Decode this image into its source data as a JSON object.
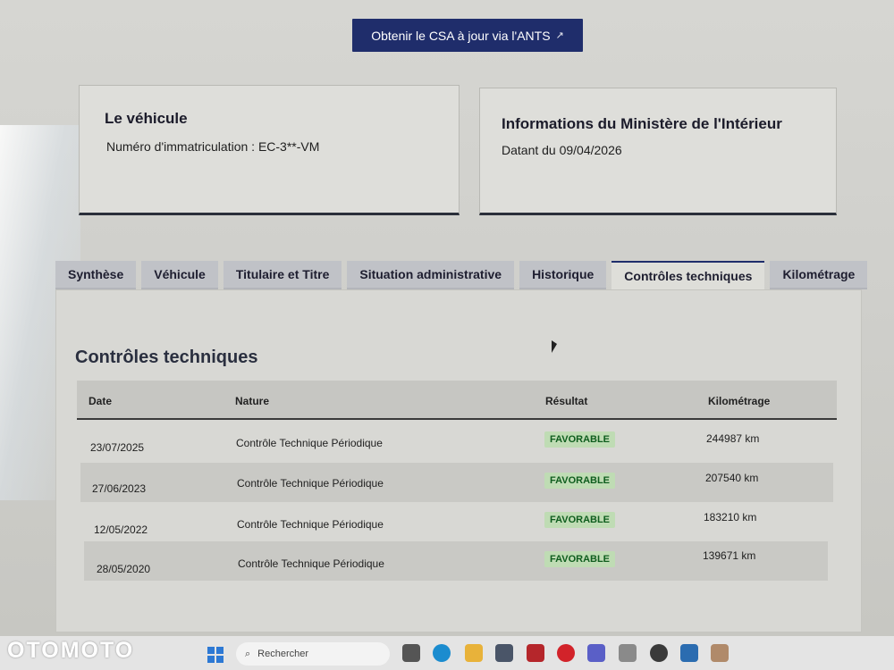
{
  "csa_button": {
    "label": "Obtenir le CSA à jour via l'ANTS",
    "icon": "external-link-icon"
  },
  "vehicle_card": {
    "title": "Le véhicule",
    "registration": "Numéro d'immatriculation : EC-3**-VM"
  },
  "ministry_card": {
    "title": "Informations du Ministère de l'Intérieur",
    "date": "Datant du 09/04/2026"
  },
  "tabs": [
    {
      "label": "Synthèse"
    },
    {
      "label": "Véhicule"
    },
    {
      "label": "Titulaire et Titre"
    },
    {
      "label": "Situation administrative"
    },
    {
      "label": "Historique"
    },
    {
      "label": "Contrôles techniques"
    },
    {
      "label": "Kilométrage"
    }
  ],
  "panel": {
    "title": "Contrôles techniques",
    "headers": {
      "date": "Date",
      "nature": "Nature",
      "result": "Résultat",
      "mileage": "Kilométrage"
    },
    "rows": [
      {
        "date": "23/07/2025",
        "nature": "Contrôle Technique Périodique",
        "result": "FAVORABLE",
        "mileage": "244987 km"
      },
      {
        "date": "27/06/2023",
        "nature": "Contrôle Technique Périodique",
        "result": "FAVORABLE",
        "mileage": "207540 km"
      },
      {
        "date": "12/05/2022",
        "nature": "Contrôle Technique Périodique",
        "result": "FAVORABLE",
        "mileage": "183210 km"
      },
      {
        "date": "28/05/2020",
        "nature": "Contrôle Technique Périodique",
        "result": "FAVORABLE",
        "mileage": "139671 km"
      }
    ]
  },
  "taskbar": {
    "search_placeholder": "Rechercher",
    "brand": "OTOMOTO"
  },
  "colors": {
    "primary": "#1f2d6b",
    "badge_bg": "#bfdcb4",
    "badge_text": "#0f5d1e"
  }
}
